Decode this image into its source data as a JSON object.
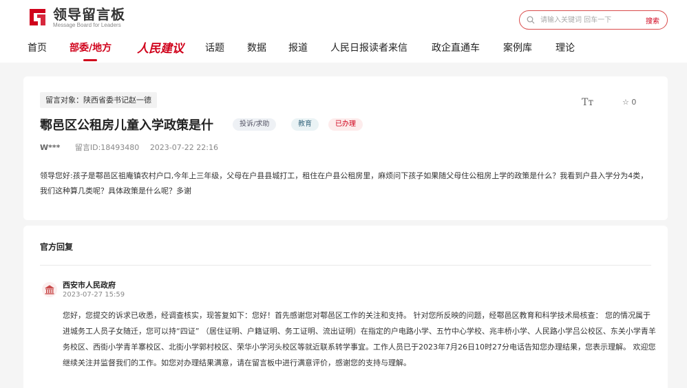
{
  "brand": {
    "title": "领导留言板",
    "subtitle": "Message Board for Leaders",
    "color": "#d0021b"
  },
  "search": {
    "placeholder": "请输入关键词 回车一下",
    "button": "搜索"
  },
  "nav": {
    "items": [
      "首页",
      "部委/地方",
      "人民建议",
      "话题",
      "数据",
      "报道",
      "人民日报读者来信",
      "政企直通车",
      "案例库",
      "理论"
    ],
    "active": "部委/地方"
  },
  "message": {
    "target": "留言对象：陕西省委书记赵一德",
    "title": "鄠邑区公租房儿童入学政策是什",
    "tags": {
      "type": "投诉/求助",
      "category": "教育",
      "status": "已办理"
    },
    "author": "W***",
    "message_id": "留言ID:18493480",
    "datetime": "2023-07-22 22:16",
    "font_size_label": "Tт",
    "favorites": "☆ 0",
    "content": "领导您好:孩子是鄠邑区祖庵镇农村户口,今年上三年级，父母在户县县城打工，租住在户县公租房里，麻烦问下孩子如果随父母住公租房上学的政策是什么？我看到户县入学分为4类，我们这种算几类呢？具体政策是什么呢？多谢"
  },
  "reply": {
    "section_title": "官方回复",
    "org": "西安市人民政府",
    "datetime": "2023-07-27 15:59",
    "content": "您好，您提交的诉求已收悉，经调查核实，现答复如下：您好！首先感谢您对鄠邑区工作的关注和支持。 针对您所反映的问题，经鄠邑区教育和科学技术局核查： 您的情况属于进城务工人员子女随迁，您可以持“四证” （居住证明、户籍证明、务工证明、流出证明）在指定的户电路小学、五竹中心学校、兆丰桥小学、人民路小学吕公校区、东关小学青羊务校区、西街小学青羊寨校区、北街小学郭村校区、荣华小学河头校区等就近联系转学事宜。工作人员已于2023年7月26日10时27分电话告知您办理结果，您表示理解。 欢迎您继续关注并监督我们的工作。如您对办理结果满意，请在留言板中进行满意评价，感谢您的支持与理解。"
  }
}
